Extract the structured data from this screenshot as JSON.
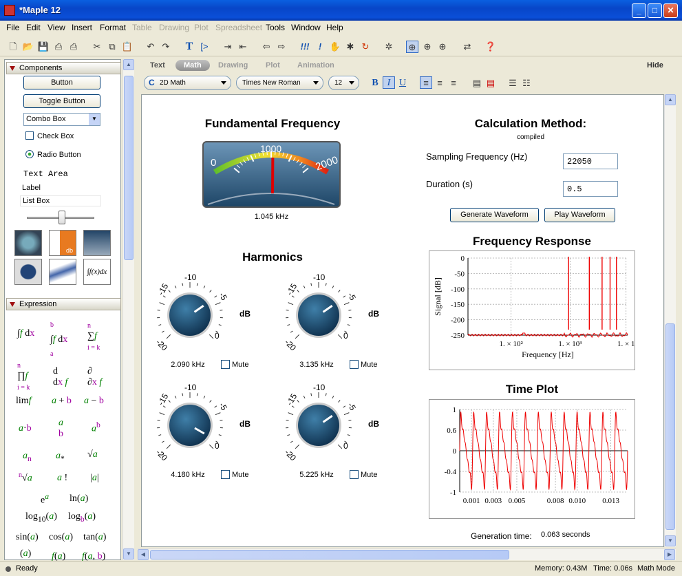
{
  "window": {
    "title": "*Maple 12"
  },
  "menu": [
    "File",
    "Edit",
    "View",
    "Insert",
    "Format",
    "Table",
    "Drawing",
    "Plot",
    "Spreadsheet",
    "Tools",
    "Window",
    "Help"
  ],
  "menu_disabled": [
    "Table",
    "Drawing",
    "Plot",
    "Spreadsheet"
  ],
  "palettes": {
    "components": {
      "title": "Components",
      "button": "Button",
      "toggle_button": "Toggle Button",
      "combo_box": "Combo Box",
      "check_box": "Check Box",
      "radio_button": "Radio Button",
      "text_area": "Text Area",
      "label": "Label",
      "list_box": "List Box",
      "db_label": "db"
    },
    "expression": {
      "title": "Expression"
    }
  },
  "doc_toolbar": {
    "tabs": [
      "Text",
      "Math",
      "Drawing",
      "Plot",
      "Animation"
    ],
    "active_tab": "Math",
    "hide": "Hide",
    "math_combo": "2D Math",
    "font_combo": "Times New Roman",
    "size_combo": "12",
    "bold": "B",
    "italic": "I",
    "underline": "U"
  },
  "fundamental": {
    "title": "Fundamental Frequency",
    "gauge_ticks": [
      "0",
      "1000",
      "2000"
    ],
    "value": "1.045 kHz",
    "gauge_level": 1045
  },
  "calc": {
    "title": "Calculation Method:",
    "method": "compiled",
    "sampling_label": "Sampling Frequency (Hz)",
    "sampling_value": "22050",
    "duration_label": "Duration (s)",
    "duration_value": "0.5",
    "generate": "Generate Waveform",
    "play": "Play Waveform"
  },
  "harmonics": {
    "title": "Harmonics",
    "knobs": [
      {
        "freq": "2.090 kHz",
        "unit": "dB",
        "mute": "Mute"
      },
      {
        "freq": "3.135 kHz",
        "unit": "dB",
        "mute": "Mute"
      },
      {
        "freq": "4.180 kHz",
        "unit": "dB",
        "mute": "Mute"
      },
      {
        "freq": "5.225 kHz",
        "unit": "dB",
        "mute": "Mute"
      }
    ],
    "scale": [
      "-20",
      "-15",
      "-10",
      "-5",
      "0"
    ]
  },
  "chart_data": [
    {
      "type": "line",
      "title": "Frequency Response",
      "xlabel": "Frequency [Hz]",
      "ylabel": "Signal [dB]",
      "x_scale": "log",
      "x_ticks": [
        "1. × 10²",
        "1. × 10³",
        "1. × 1"
      ],
      "y_ticks": [
        "0",
        "-50",
        "-100",
        "-150",
        "-200",
        "-250"
      ],
      "ylim": [
        -270,
        5
      ],
      "grid": true
    },
    {
      "type": "line",
      "title": "Time Plot",
      "x_ticks": [
        "0.001",
        "0.003",
        "0.005",
        "0.008",
        "0.010",
        "0.013"
      ],
      "y_ticks": [
        "1",
        "0.6",
        "0",
        "-0.4",
        "-1"
      ],
      "ylim": [
        -1,
        1
      ],
      "grid": true
    }
  ],
  "generation": {
    "label": "Generation time:",
    "value": "0.063 seconds"
  },
  "status": {
    "ready": "Ready",
    "memory": "Memory: 0.43M",
    "time": "Time: 0.06s",
    "mode": "Math Mode"
  }
}
